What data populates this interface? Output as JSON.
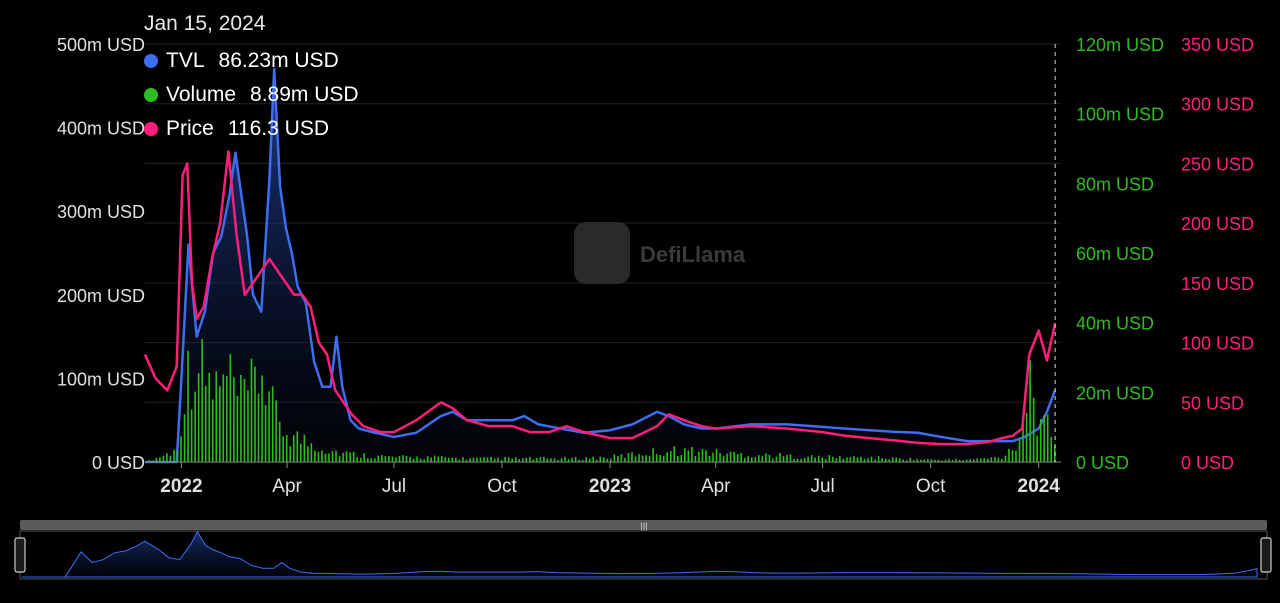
{
  "tooltip": {
    "date": "Jan 15, 2024",
    "rows": [
      {
        "label": "TVL",
        "value": "86.23m USD"
      },
      {
        "label": "Volume",
        "value": "8.89m USD"
      },
      {
        "label": "Price",
        "value": "116.3 USD"
      }
    ]
  },
  "watermark": "DefiLlama",
  "colors": {
    "tvl": "#3d6df2",
    "volume": "#2dbd1f",
    "price": "#ff1f7a",
    "background": "#000000"
  },
  "chart_data": {
    "type": "line",
    "xlabel": "",
    "x_range": [
      "2021-12-01",
      "2024-01-20"
    ],
    "x_tick_labels": [
      {
        "date": "2022-01-01",
        "label": "2022",
        "bold": true
      },
      {
        "date": "2022-04-01",
        "label": "Apr",
        "bold": false
      },
      {
        "date": "2022-07-01",
        "label": "Jul",
        "bold": false
      },
      {
        "date": "2022-10-01",
        "label": "Oct",
        "bold": false
      },
      {
        "date": "2023-01-01",
        "label": "2023",
        "bold": true
      },
      {
        "date": "2023-04-01",
        "label": "Apr",
        "bold": false
      },
      {
        "date": "2023-07-01",
        "label": "Jul",
        "bold": false
      },
      {
        "date": "2023-10-01",
        "label": "Oct",
        "bold": false
      },
      {
        "date": "2024-01-01",
        "label": "2024",
        "bold": true
      }
    ],
    "crosshair_date": "2024-01-15",
    "axes": {
      "tvl": {
        "ylim": [
          0,
          500
        ],
        "ticks": [
          "0 USD",
          "100m USD",
          "200m USD",
          "300m USD",
          "400m USD",
          "500m USD"
        ]
      },
      "volume": {
        "ylim": [
          0,
          120
        ],
        "ticks": [
          "0 USD",
          "20m USD",
          "40m USD",
          "60m USD",
          "80m USD",
          "100m USD",
          "120m USD"
        ]
      },
      "price": {
        "ylim": [
          0,
          350
        ],
        "ticks": [
          "0 USD",
          "50 USD",
          "100 USD",
          "150 USD",
          "200 USD",
          "250 USD",
          "300 USD",
          "350 USD"
        ]
      }
    },
    "grid": true,
    "legend": "top-left",
    "series": [
      {
        "name": "TVL",
        "axis": "tvl",
        "style": "area",
        "x": [
          "2021-12-01",
          "2021-12-28",
          "2022-01-01",
          "2022-01-07",
          "2022-01-14",
          "2022-01-21",
          "2022-01-28",
          "2022-02-04",
          "2022-02-11",
          "2022-02-16",
          "2022-02-20",
          "2022-02-26",
          "2022-03-03",
          "2022-03-10",
          "2022-03-17",
          "2022-03-21",
          "2022-03-26",
          "2022-03-31",
          "2022-04-05",
          "2022-04-10",
          "2022-04-17",
          "2022-04-24",
          "2022-05-01",
          "2022-05-08",
          "2022-05-13",
          "2022-05-18",
          "2022-05-25",
          "2022-06-01",
          "2022-06-15",
          "2022-07-01",
          "2022-07-20",
          "2022-08-10",
          "2022-08-20",
          "2022-09-01",
          "2022-09-20",
          "2022-10-10",
          "2022-10-20",
          "2022-11-01",
          "2022-11-20",
          "2022-12-10",
          "2023-01-01",
          "2023-01-20",
          "2023-02-10",
          "2023-02-20",
          "2023-03-05",
          "2023-03-20",
          "2023-04-01",
          "2023-05-01",
          "2023-06-01",
          "2023-07-01",
          "2023-07-20",
          "2023-08-10",
          "2023-09-01",
          "2023-09-20",
          "2023-10-10",
          "2023-11-01",
          "2023-11-20",
          "2023-12-01",
          "2023-12-10",
          "2023-12-20",
          "2024-01-01",
          "2024-01-08",
          "2024-01-15"
        ],
        "values": [
          0,
          0,
          100,
          260,
          150,
          180,
          250,
          270,
          320,
          370,
          330,
          270,
          200,
          180,
          340,
          470,
          330,
          280,
          250,
          210,
          190,
          120,
          90,
          90,
          150,
          90,
          50,
          40,
          35,
          30,
          35,
          55,
          60,
          50,
          50,
          50,
          55,
          45,
          40,
          35,
          38,
          45,
          60,
          55,
          45,
          40,
          40,
          45,
          45,
          42,
          40,
          38,
          36,
          35,
          30,
          25,
          25,
          25,
          25,
          30,
          40,
          60,
          86
        ]
      },
      {
        "name": "Volume",
        "axis": "volume",
        "style": "bars",
        "x": [
          "2021-12-01",
          "2021-12-28",
          "2022-01-01",
          "2022-01-10",
          "2022-01-20",
          "2022-02-01",
          "2022-02-10",
          "2022-02-20",
          "2022-03-01",
          "2022-03-10",
          "2022-03-20",
          "2022-04-01",
          "2022-04-10",
          "2022-04-20",
          "2022-05-01",
          "2022-05-15",
          "2022-06-01",
          "2022-07-01",
          "2022-08-01",
          "2022-09-01",
          "2022-10-01",
          "2022-11-01",
          "2022-12-01",
          "2023-01-01",
          "2023-02-01",
          "2023-03-01",
          "2023-04-01",
          "2023-05-01",
          "2023-06-01",
          "2023-07-01",
          "2023-08-01",
          "2023-09-01",
          "2023-10-01",
          "2023-11-01",
          "2023-12-01",
          "2023-12-15",
          "2023-12-25",
          "2024-01-01",
          "2024-01-08",
          "2024-01-15"
        ],
        "values": [
          0,
          5,
          25,
          45,
          35,
          30,
          35,
          25,
          30,
          40,
          20,
          12,
          10,
          8,
          6,
          4,
          3,
          2,
          2,
          1.5,
          1.5,
          1.5,
          1.5,
          2,
          4,
          5,
          4,
          3,
          2.5,
          2,
          2,
          1.5,
          1,
          1,
          2,
          10,
          40,
          12,
          15,
          8.89
        ]
      },
      {
        "name": "Price",
        "axis": "price",
        "x": [
          "2021-12-01",
          "2021-12-10",
          "2021-12-20",
          "2021-12-28",
          "2022-01-02",
          "2022-01-06",
          "2022-01-10",
          "2022-01-14",
          "2022-01-20",
          "2022-01-27",
          "2022-02-03",
          "2022-02-10",
          "2022-02-17",
          "2022-02-24",
          "2022-03-03",
          "2022-03-10",
          "2022-03-17",
          "2022-03-24",
          "2022-03-31",
          "2022-04-07",
          "2022-04-14",
          "2022-04-21",
          "2022-04-28",
          "2022-05-05",
          "2022-05-12",
          "2022-05-19",
          "2022-05-26",
          "2022-06-05",
          "2022-06-20",
          "2022-07-01",
          "2022-07-20",
          "2022-08-10",
          "2022-08-20",
          "2022-09-01",
          "2022-09-20",
          "2022-10-10",
          "2022-10-25",
          "2022-11-10",
          "2022-11-25",
          "2022-12-10",
          "2023-01-01",
          "2023-01-20",
          "2023-02-10",
          "2023-02-20",
          "2023-03-05",
          "2023-03-20",
          "2023-04-01",
          "2023-05-01",
          "2023-06-01",
          "2023-07-01",
          "2023-07-20",
          "2023-08-10",
          "2023-09-01",
          "2023-09-20",
          "2023-10-10",
          "2023-11-01",
          "2023-11-20",
          "2023-12-01",
          "2023-12-10",
          "2023-12-18",
          "2023-12-24",
          "2024-01-01",
          "2024-01-08",
          "2024-01-15"
        ],
        "values": [
          90,
          70,
          60,
          80,
          240,
          250,
          150,
          120,
          130,
          170,
          200,
          260,
          190,
          140,
          150,
          160,
          170,
          160,
          150,
          140,
          140,
          130,
          100,
          90,
          60,
          50,
          40,
          30,
          25,
          25,
          35,
          50,
          45,
          35,
          30,
          30,
          25,
          25,
          30,
          25,
          20,
          20,
          30,
          40,
          35,
          30,
          28,
          30,
          28,
          25,
          22,
          20,
          18,
          16,
          15,
          15,
          17,
          20,
          22,
          28,
          90,
          110,
          85,
          116.3
        ]
      }
    ]
  }
}
